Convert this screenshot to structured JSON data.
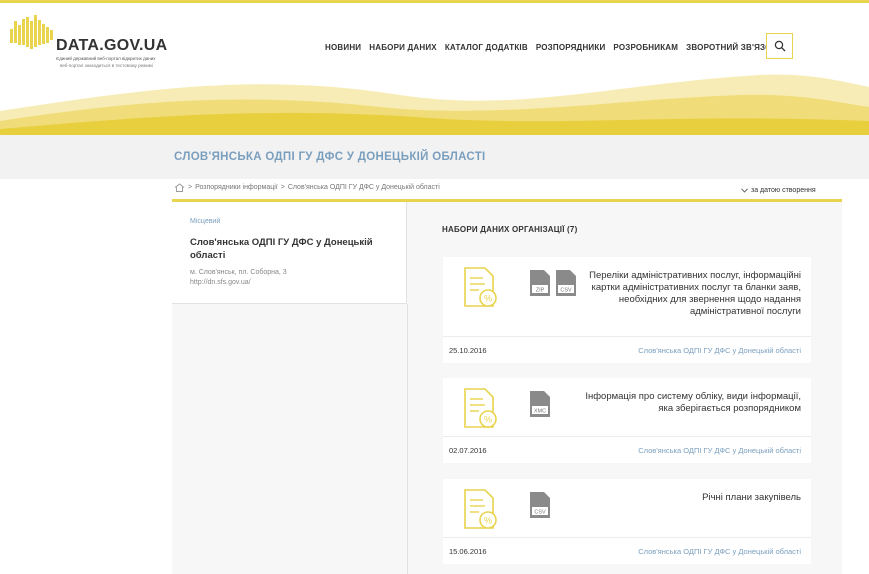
{
  "logo": {
    "title": "DATA.GOV.UA",
    "subtitle1": "Єдиний державний веб-портал відкритих даних",
    "subtitle2": "веб-портал знаходиться в тестовому режимі",
    "accent_color": "#e8d44d"
  },
  "nav": {
    "items": [
      {
        "label": "НОВИНИ"
      },
      {
        "label": "НАБОРИ ДАНИХ"
      },
      {
        "label": "КАТАЛОГ ДОДАТКІВ"
      },
      {
        "label": "РОЗПОРЯДНИКИ"
      },
      {
        "label": "РОЗРОБНИКАМ"
      },
      {
        "label": "ЗВОРОТНИЙ ЗВ'ЯЗОК"
      }
    ],
    "search_icon": "search-icon"
  },
  "page": {
    "title": "СЛОВ'ЯНСЬКА ОДПІ ГУ ДФС У ДОНЕЦЬКІЙ ОБЛАСТІ"
  },
  "breadcrumb": {
    "home_icon": "home-icon",
    "sep": ">",
    "items": [
      {
        "label": "Розпорядники інформації"
      },
      {
        "label": "Слов'янська ОДПІ ГУ ДФС у Донецькій області"
      }
    ]
  },
  "sort": {
    "label": "за датою створення",
    "icon": "chevron-down-icon"
  },
  "organization": {
    "type": "Місцевий",
    "name": "Слов'янська ОДПІ ГУ ДФС у Донецькій області",
    "address": "м. Слов'янськ, пл. Соборна, 3",
    "url": "http://dn.sfs.gov.ua/"
  },
  "datasets": {
    "heading": "НАБОРИ ДАНИХ ОРГАНІЗАЦІЇ (7)",
    "items": [
      {
        "title": "Переліки адміністративних послуг, інформаційні картки адміністративних послуг та бланки заяв, необхідних для звернення щодо надання адміністративної послуги",
        "formats": [
          "ZIP",
          "CSV"
        ],
        "date": "25.10.2016",
        "org": "Слов'янська ОДПІ ГУ ДФС у Донецькій області"
      },
      {
        "title": "Інформація про систему обліку, види інформації, яка зберігається розпорядником",
        "formats": [
          "XMC"
        ],
        "date": "02.07.2016",
        "org": "Слов'янська ОДПІ ГУ ДФС у Донецькій області"
      },
      {
        "title": "Річні плани закупівель",
        "formats": [
          "CSV"
        ],
        "date": "15.06.2016",
        "org": "Слов'янська ОДПІ ГУ ДФС у Донецькій області"
      }
    ]
  }
}
